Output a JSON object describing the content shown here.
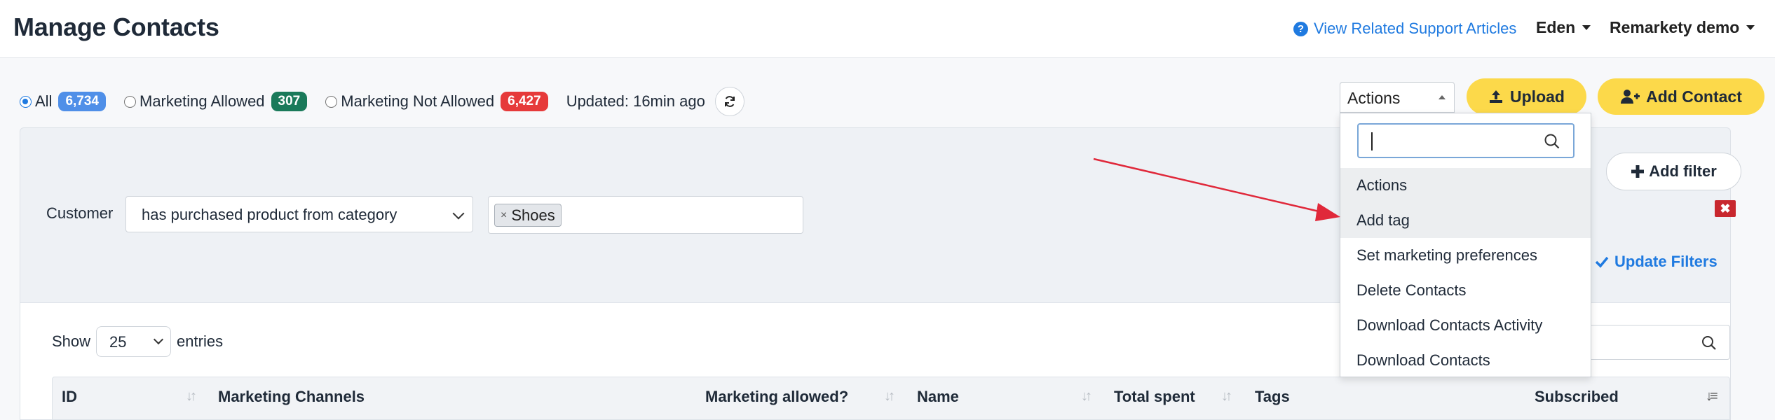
{
  "header": {
    "title": "Manage Contacts",
    "support_link": "View Related Support Articles",
    "user": "Eden",
    "account": "Remarkety demo"
  },
  "segments": [
    {
      "label": "All",
      "count": "6,734",
      "color": "#4f8fe8",
      "checked": true
    },
    {
      "label": "Marketing Allowed",
      "count": "307",
      "color": "#1a7a5a",
      "checked": false
    },
    {
      "label": "Marketing Not Allowed",
      "count": "6,427",
      "color": "#e63a3a",
      "checked": false
    }
  ],
  "updated_text": "Updated: 16min ago",
  "toolbar": {
    "actions_label": "Actions",
    "upload_label": "Upload",
    "add_contact_label": "Add Contact"
  },
  "filter": {
    "label": "Customer",
    "condition": "has purchased product from category",
    "tags": [
      "Shoes"
    ],
    "add_filter_label": "Add filter",
    "update_filters_label": "Update Filters"
  },
  "table": {
    "show_label": "Show",
    "entries_value": "25",
    "entries_label": "entries",
    "columns": [
      "ID",
      "Marketing Channels",
      "Marketing allowed?",
      "Name",
      "Total spent",
      "Tags",
      "Subscribed"
    ]
  },
  "actions_dropdown": {
    "search_value": "",
    "items": [
      "Actions",
      "Add tag",
      "Set marketing preferences",
      "Delete Contacts",
      "Download Contacts Activity",
      "Download Contacts"
    ],
    "highlighted": [
      0,
      1
    ]
  },
  "colors": {
    "accent_blue": "#1f7ae0",
    "button_yellow": "#fcd94a",
    "annotation_arrow": "#e0283a"
  }
}
